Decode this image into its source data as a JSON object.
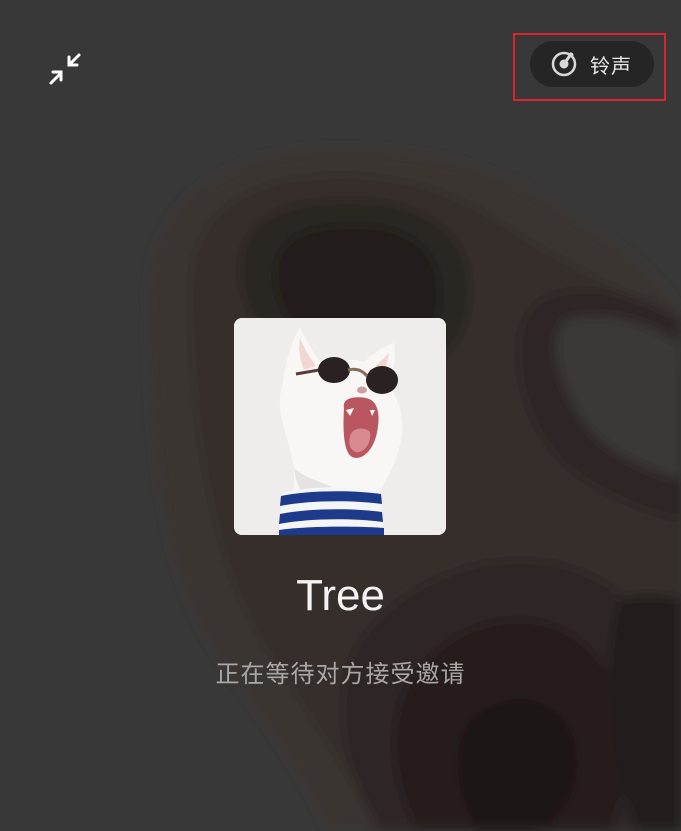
{
  "call": {
    "contact_name": "Tree",
    "status": "正在等待对方接受邀请"
  },
  "toolbar": {
    "ringtone_label": "铃声",
    "minimize_icon": "minimize-arrows-icon",
    "ringtone_icon": "music-disc-icon"
  },
  "avatar": {
    "description_icon": "cat-with-sunglasses-avatar"
  },
  "colors": {
    "background": "#393838",
    "highlight_border": "#d8262e",
    "pill_background": "#262525",
    "name_text": "#f4f4f4",
    "status_text": "#a9a8a8"
  }
}
